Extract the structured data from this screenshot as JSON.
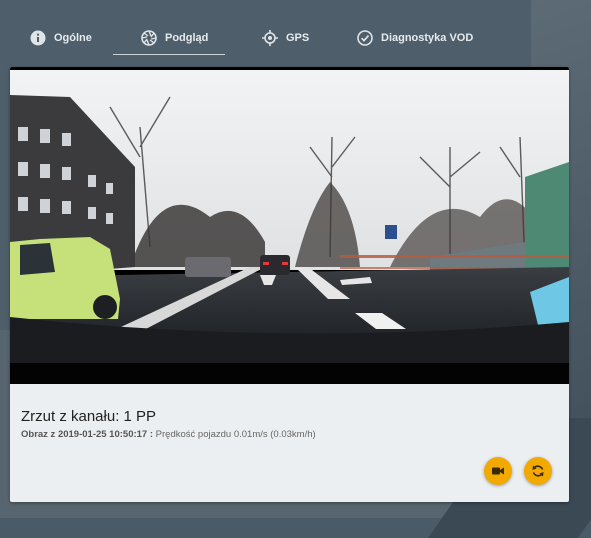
{
  "tabs": [
    {
      "label": "Ogólne",
      "icon": "info-icon"
    },
    {
      "label": "Podgląd",
      "icon": "aperture-icon"
    },
    {
      "label": "GPS",
      "icon": "crosshair-icon"
    },
    {
      "label": "Diagnostyka VOD",
      "icon": "check-circle-icon"
    }
  ],
  "active_tab": "Podgląd",
  "preview": {
    "title": "Zrzut z kanału: 1 PP",
    "image_label": "Obraz z 2019-01-25 10:50:17 :",
    "speed_text": " Prędkość pojazdu 0.01m/s (0.03km/h)"
  },
  "actions": [
    {
      "name": "record-button",
      "icon": "video-camera-icon"
    },
    {
      "name": "refresh-button",
      "icon": "refresh-icon"
    }
  ],
  "colors": {
    "accent": "#f2a900",
    "background": "#4e5e6a",
    "card": "#eceff1"
  }
}
